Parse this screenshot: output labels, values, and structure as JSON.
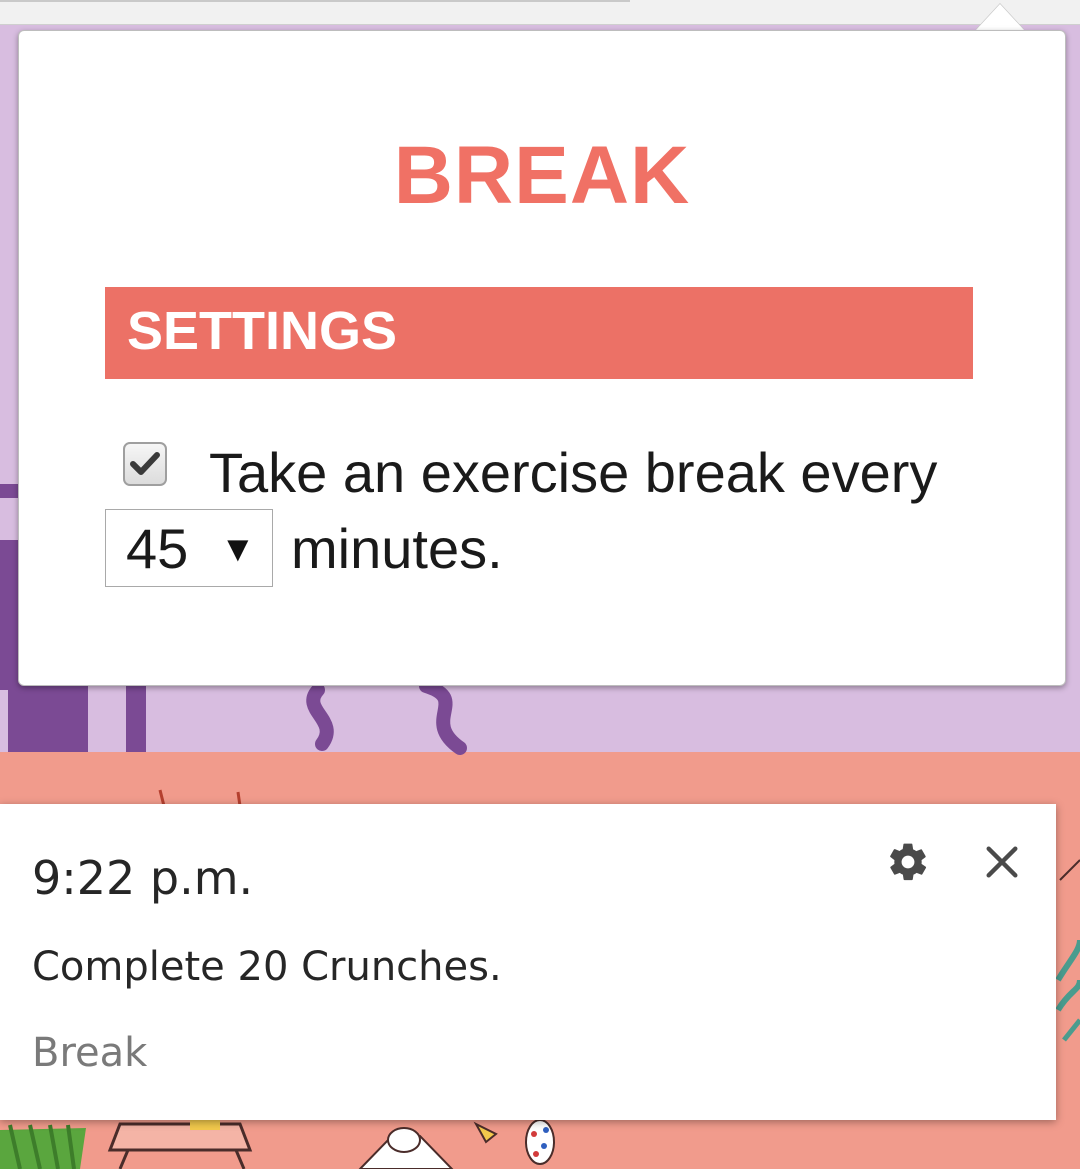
{
  "popup": {
    "app_title": "BREAK",
    "settings_title": "SETTINGS",
    "exercise_checkbox": {
      "checked": true
    },
    "preference_text": "Take an exercise break every",
    "interval_select": {
      "selected": "45",
      "arrow": "▼"
    },
    "unit_text": "minutes.",
    "accent_color": "#ec7166"
  },
  "notification": {
    "time": "9:22 p.m.",
    "message": "Complete 20 Crunches.",
    "source": "Break",
    "icons": [
      "gear-icon",
      "close-icon"
    ]
  }
}
